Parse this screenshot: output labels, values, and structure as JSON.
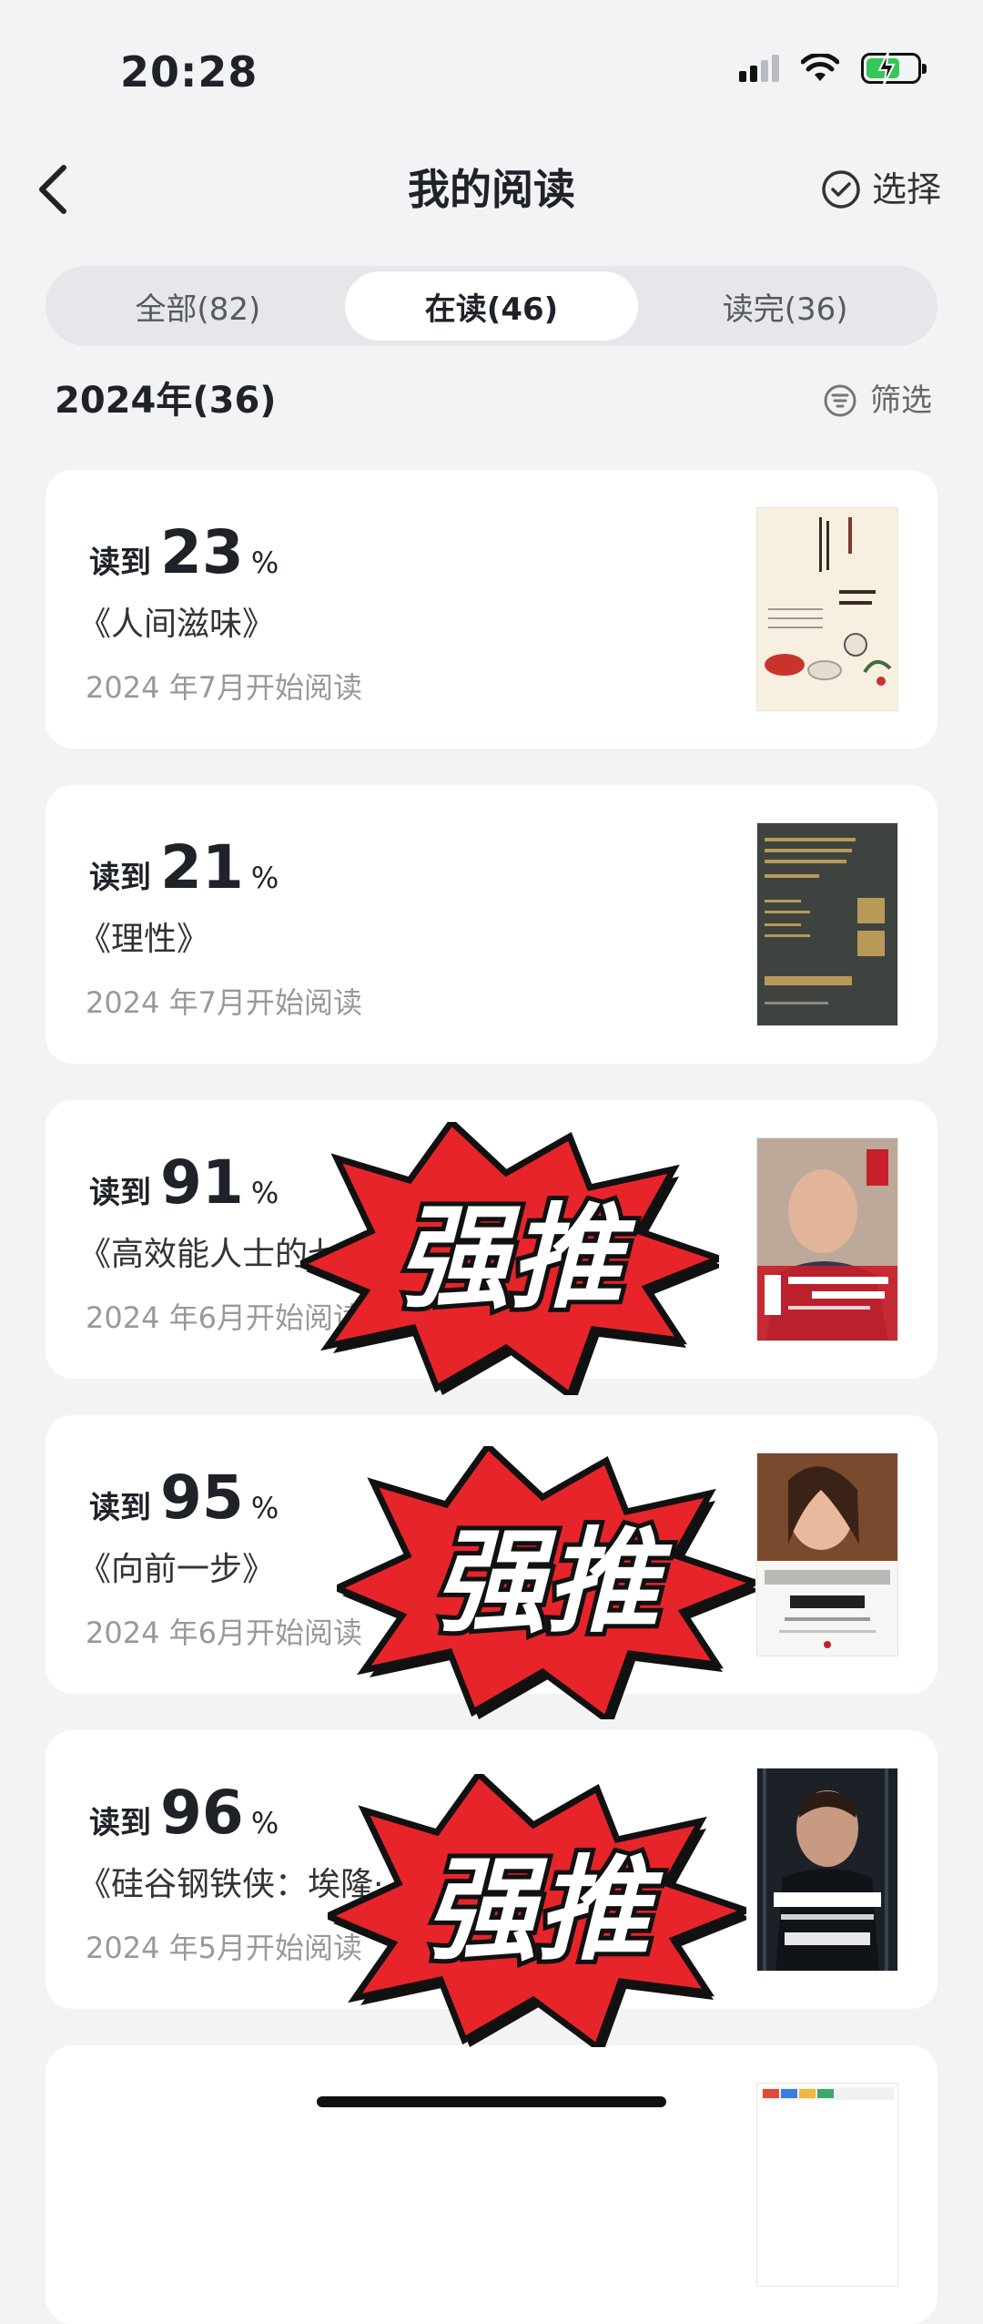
{
  "status_bar": {
    "time": "20:28"
  },
  "nav": {
    "title": "我的阅读",
    "select_label": "选择"
  },
  "tabs": [
    {
      "label": "全部(82)",
      "active": false
    },
    {
      "label": "在读(46)",
      "active": true
    },
    {
      "label": "读完(36)",
      "active": false
    }
  ],
  "section": {
    "year_label": "2024年(36)",
    "filter_label": "筛选"
  },
  "progress_prefix": "读到",
  "percent_sign": "%",
  "sticker_text": "强推",
  "books": [
    {
      "percent": "23",
      "title": "《人间滋味》",
      "start": "2024 年7月开始阅读"
    },
    {
      "percent": "21",
      "title": "《理性》",
      "start": "2024 年7月开始阅读"
    },
    {
      "percent": "91",
      "title": "《高效能人士的七个",
      "start": "2024 年6月开始阅读"
    },
    {
      "percent": "95",
      "title": "《向前一步》",
      "start": "2024 年6月开始阅读"
    },
    {
      "percent": "96",
      "title": "《硅谷钢铁侠：埃隆·",
      "start": "2024 年5月开始阅读"
    }
  ],
  "colors": {
    "accent_green": "#34c759",
    "sticker_red": "#e8242b"
  }
}
